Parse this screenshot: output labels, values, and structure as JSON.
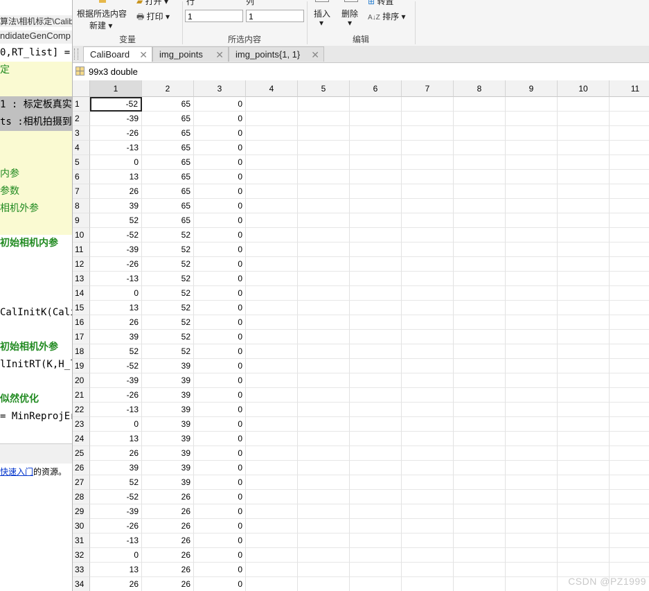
{
  "left_editor": {
    "path": "算法\\相机标定\\Calib",
    "file": "ndidateGenComp",
    "code_lines": [
      {
        "text": "0,RT_list] =",
        "color": "#000000",
        "bg": "#ffffff"
      },
      {
        "text": "定",
        "color": "#228B22",
        "bg": "#fafad2"
      },
      {
        "text": "",
        "color": "#000000",
        "bg": "#fafad2"
      },
      {
        "text": "1 : 标定板真实",
        "color": "#000000",
        "bg": "#c0c0c0"
      },
      {
        "text": "ts :相机拍摄到",
        "color": "#000000",
        "bg": "#c0c0c0"
      },
      {
        "text": "",
        "color": "#000000",
        "bg": "#fafad2"
      },
      {
        "text": "",
        "color": "#000000",
        "bg": "#fafad2"
      },
      {
        "text": "内参",
        "color": "#228B22",
        "bg": "#fafad2"
      },
      {
        "text": "参数",
        "color": "#228B22",
        "bg": "#fafad2"
      },
      {
        "text": " 相机外参",
        "color": "#228B22",
        "bg": "#fafad2"
      },
      {
        "text": "",
        "color": "#000000",
        "bg": "#fafad2"
      },
      {
        "text": "初始相机内参",
        "color": "#228B22",
        "bg": "#ffffff",
        "bold": true
      },
      {
        "text": "",
        "color": "#000000",
        "bg": "#ffffff"
      },
      {
        "text": "",
        "color": "#000000",
        "bg": "#ffffff"
      },
      {
        "text": "",
        "color": "#000000",
        "bg": "#ffffff"
      },
      {
        "text": " CalInitK(Cali",
        "color": "#000000",
        "bg": "#ffffff"
      },
      {
        "text": "",
        "color": "#000000",
        "bg": "#ffffff"
      },
      {
        "text": "初始相机外参",
        "color": "#228B22",
        "bg": "#ffffff",
        "bold": true
      },
      {
        "text": "lInitRT(K,H_li",
        "color": "#000000",
        "bg": "#ffffff"
      },
      {
        "text": "",
        "color": "#000000",
        "bg": "#ffffff"
      },
      {
        "text": "似然优化",
        "color": "#228B22",
        "bg": "#ffffff",
        "bold": true
      },
      {
        "text": "= MinReprojErr",
        "color": "#000000",
        "bg": "#ffffff"
      }
    ],
    "hint_link": "快速入门",
    "hint_suffix": "的资源。"
  },
  "ribbon": {
    "variable_section": "变量",
    "new_from_selection": "根据所选内容",
    "new_label": "新建",
    "open_label": "打开",
    "print_label": "打印",
    "selection_section": "所选内容",
    "row_label": "行",
    "col_label": "列",
    "row_value": "1",
    "col_value": "1",
    "edit_section": "编辑",
    "insert_label": "插入",
    "delete_label": "删除",
    "transpose_label": "转置",
    "sort_label": "排序"
  },
  "tabs": [
    {
      "label": "CaliBoard",
      "active": true
    },
    {
      "label": "img_points",
      "active": false
    },
    {
      "label": "img_points{1, 1}",
      "active": false
    }
  ],
  "variable_info": "99x3 double",
  "grid": {
    "columns": [
      "1",
      "2",
      "3",
      "4",
      "5",
      "6",
      "7",
      "8",
      "9",
      "10",
      "11"
    ],
    "rows": [
      [
        "1",
        "-52",
        "65",
        "0"
      ],
      [
        "2",
        "-39",
        "65",
        "0"
      ],
      [
        "3",
        "-26",
        "65",
        "0"
      ],
      [
        "4",
        "-13",
        "65",
        "0"
      ],
      [
        "5",
        "0",
        "65",
        "0"
      ],
      [
        "6",
        "13",
        "65",
        "0"
      ],
      [
        "7",
        "26",
        "65",
        "0"
      ],
      [
        "8",
        "39",
        "65",
        "0"
      ],
      [
        "9",
        "52",
        "65",
        "0"
      ],
      [
        "10",
        "-52",
        "52",
        "0"
      ],
      [
        "11",
        "-39",
        "52",
        "0"
      ],
      [
        "12",
        "-26",
        "52",
        "0"
      ],
      [
        "13",
        "-13",
        "52",
        "0"
      ],
      [
        "14",
        "0",
        "52",
        "0"
      ],
      [
        "15",
        "13",
        "52",
        "0"
      ],
      [
        "16",
        "26",
        "52",
        "0"
      ],
      [
        "17",
        "39",
        "52",
        "0"
      ],
      [
        "18",
        "52",
        "52",
        "0"
      ],
      [
        "19",
        "-52",
        "39",
        "0"
      ],
      [
        "20",
        "-39",
        "39",
        "0"
      ],
      [
        "21",
        "-26",
        "39",
        "0"
      ],
      [
        "22",
        "-13",
        "39",
        "0"
      ],
      [
        "23",
        "0",
        "39",
        "0"
      ],
      [
        "24",
        "13",
        "39",
        "0"
      ],
      [
        "25",
        "26",
        "39",
        "0"
      ],
      [
        "26",
        "39",
        "39",
        "0"
      ],
      [
        "27",
        "52",
        "39",
        "0"
      ],
      [
        "28",
        "-52",
        "26",
        "0"
      ],
      [
        "29",
        "-39",
        "26",
        "0"
      ],
      [
        "30",
        "-26",
        "26",
        "0"
      ],
      [
        "31",
        "-13",
        "26",
        "0"
      ],
      [
        "32",
        "0",
        "26",
        "0"
      ],
      [
        "33",
        "13",
        "26",
        "0"
      ],
      [
        "34",
        "26",
        "26",
        "0"
      ]
    ]
  },
  "watermark": "CSDN @PZ1999"
}
